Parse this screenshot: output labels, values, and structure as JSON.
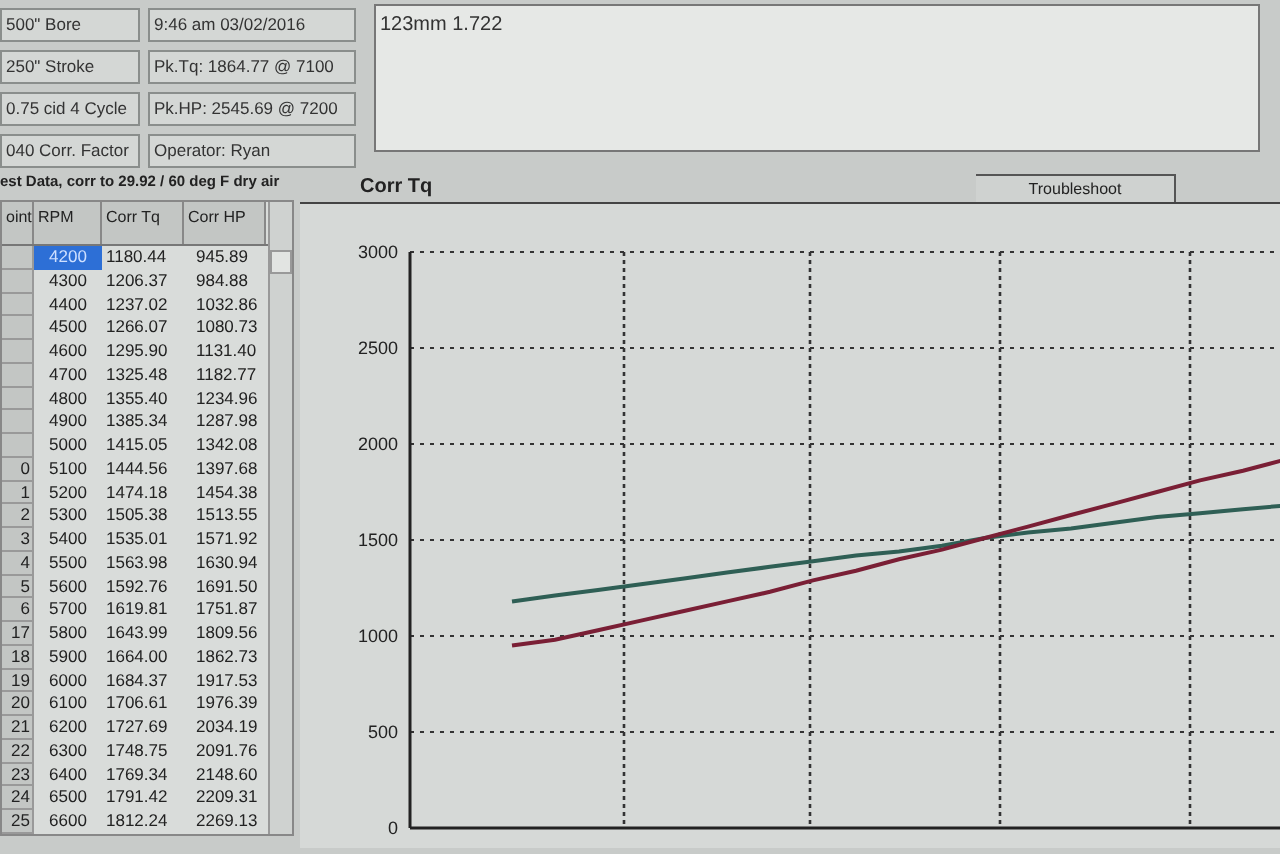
{
  "info_fields": [
    {
      "text": "500\" Bore"
    },
    {
      "text": "250\" Stroke"
    },
    {
      "text": "0.75 cid 4 Cycle"
    },
    {
      "text": "040 Corr. Factor"
    }
  ],
  "run_fields": [
    {
      "text": "9:46 am  03/02/2016"
    },
    {
      "text": "Pk.Tq: 1864.77 @  7100"
    },
    {
      "text": "Pk.HP: 2545.69 @  7200"
    },
    {
      "text": "Operator: Ryan"
    }
  ],
  "test_comments": {
    "value": "123mm 1.722"
  },
  "data_title": "est Data, corr to 29.92 / 60 deg F dry air",
  "table": {
    "columns": [
      "oint",
      "RPM",
      "Corr Tq",
      "Corr HP"
    ],
    "rows": [
      {
        "point": "",
        "rpm": "4200",
        "tq": "1180.44",
        "hp": "945.89",
        "selected": true
      },
      {
        "point": "",
        "rpm": "4300",
        "tq": "1206.37",
        "hp": "984.88",
        "selected": false
      },
      {
        "point": "",
        "rpm": "4400",
        "tq": "1237.02",
        "hp": "1032.86",
        "selected": false
      },
      {
        "point": "",
        "rpm": "4500",
        "tq": "1266.07",
        "hp": "1080.73",
        "selected": false
      },
      {
        "point": "",
        "rpm": "4600",
        "tq": "1295.90",
        "hp": "1131.40",
        "selected": false
      },
      {
        "point": "",
        "rpm": "4700",
        "tq": "1325.48",
        "hp": "1182.77",
        "selected": false
      },
      {
        "point": "",
        "rpm": "4800",
        "tq": "1355.40",
        "hp": "1234.96",
        "selected": false
      },
      {
        "point": "",
        "rpm": "4900",
        "tq": "1385.34",
        "hp": "1287.98",
        "selected": false
      },
      {
        "point": "",
        "rpm": "5000",
        "tq": "1415.05",
        "hp": "1342.08",
        "selected": false
      },
      {
        "point": "0",
        "rpm": "5100",
        "tq": "1444.56",
        "hp": "1397.68",
        "selected": false
      },
      {
        "point": "1",
        "rpm": "5200",
        "tq": "1474.18",
        "hp": "1454.38",
        "selected": false
      },
      {
        "point": "2",
        "rpm": "5300",
        "tq": "1505.38",
        "hp": "1513.55",
        "selected": false
      },
      {
        "point": "3",
        "rpm": "5400",
        "tq": "1535.01",
        "hp": "1571.92",
        "selected": false
      },
      {
        "point": "4",
        "rpm": "5500",
        "tq": "1563.98",
        "hp": "1630.94",
        "selected": false
      },
      {
        "point": "5",
        "rpm": "5600",
        "tq": "1592.76",
        "hp": "1691.50",
        "selected": false
      },
      {
        "point": "6",
        "rpm": "5700",
        "tq": "1619.81",
        "hp": "1751.87",
        "selected": false
      },
      {
        "point": "17",
        "rpm": "5800",
        "tq": "1643.99",
        "hp": "1809.56",
        "selected": false
      },
      {
        "point": "18",
        "rpm": "5900",
        "tq": "1664.00",
        "hp": "1862.73",
        "selected": false
      },
      {
        "point": "19",
        "rpm": "6000",
        "tq": "1684.37",
        "hp": "1917.53",
        "selected": false
      },
      {
        "point": "20",
        "rpm": "6100",
        "tq": "1706.61",
        "hp": "1976.39",
        "selected": false
      },
      {
        "point": "21",
        "rpm": "6200",
        "tq": "1727.69",
        "hp": "2034.19",
        "selected": false
      },
      {
        "point": "22",
        "rpm": "6300",
        "tq": "1748.75",
        "hp": "2091.76",
        "selected": false
      },
      {
        "point": "23",
        "rpm": "6400",
        "tq": "1769.34",
        "hp": "2148.60",
        "selected": false
      },
      {
        "point": "24",
        "rpm": "6500",
        "tq": "1791.42",
        "hp": "2209.31",
        "selected": false
      },
      {
        "point": "25",
        "rpm": "6600",
        "tq": "1812.24",
        "hp": "2269.13",
        "selected": false
      }
    ]
  },
  "chart_panel": {
    "title": "Corr Tq",
    "tabs": [
      {
        "label": "Troubleshoot",
        "selected": false
      }
    ],
    "chart_data": {
      "type": "line",
      "grid": true,
      "ylim": [
        0,
        3000
      ],
      "yticks": [
        0,
        500,
        1000,
        1500,
        2000,
        2500,
        3000
      ],
      "series": [
        {
          "color": "#2f5f55",
          "values": [
            1180,
            1210,
            1240,
            1270,
            1300,
            1330,
            1360,
            1390,
            1420,
            1440,
            1470,
            1510,
            1540,
            1560,
            1590,
            1620,
            1640,
            1660,
            1680
          ]
        },
        {
          "color": "#7a1f35",
          "values": [
            950,
            980,
            1030,
            1080,
            1130,
            1180,
            1230,
            1290,
            1340,
            1400,
            1450,
            1510,
            1570,
            1630,
            1690,
            1750,
            1810,
            1860,
            1920
          ]
        }
      ]
    }
  }
}
